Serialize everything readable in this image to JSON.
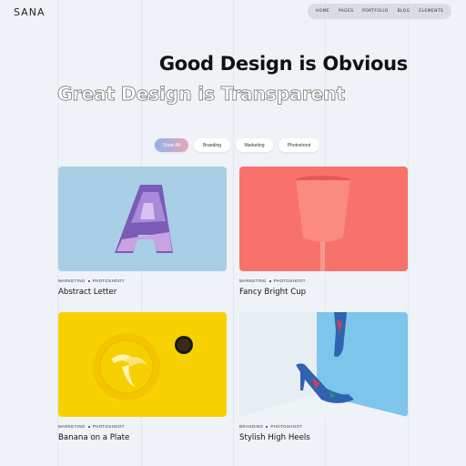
{
  "brand": {
    "logo": "SANA"
  },
  "nav": {
    "items": [
      "HOME",
      "PAGES",
      "PORTFOLIO",
      "BLOG",
      "ELEMENTS"
    ]
  },
  "hero": {
    "headline": "Good Design is Obvious",
    "outline_headline": "Great Design is Transparent"
  },
  "filters": {
    "active": "Show All",
    "items": [
      "Show All",
      "Branding",
      "Marketing",
      "Photoshoot"
    ]
  },
  "portfolio": [
    {
      "title": "Abstract Letter",
      "category_1": "MARKETING",
      "category_2": "PHOTOSHOOT"
    },
    {
      "title": "Fancy Bright Cup",
      "category_1": "MARKETING",
      "category_2": "PHOTOSHOOT"
    },
    {
      "title": "Banana on a Plate",
      "category_1": "MARKETING",
      "category_2": "PHOTOSHOOT"
    },
    {
      "title": "Stylish High Heels",
      "category_1": "BRANDING",
      "category_2": "PHOTOSHOOT"
    }
  ],
  "colors": {
    "background": "#eff2f7",
    "nav_bg": "#d9dde3",
    "pill_active_gradient": [
      "#8fb1ec",
      "#e7a7b6"
    ],
    "thumb_blue": "#a9cfe6",
    "thumb_coral": "#f7726a",
    "thumb_yellow": "#f7d200",
    "thumb_sky": "#7dc5ea"
  },
  "icons": [
    "letter-a-art-icon",
    "coral-cup-icon",
    "banana-plate-icon",
    "high-heels-icon"
  ]
}
